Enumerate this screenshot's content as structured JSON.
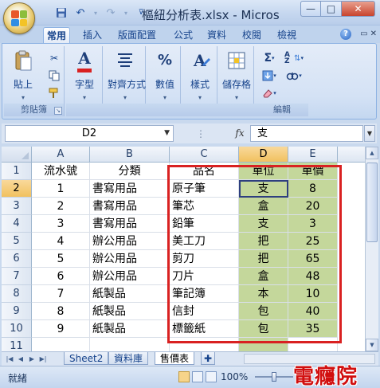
{
  "window": {
    "title": "樞紐分析表.xlsx - Micros",
    "minimize": "—",
    "maximize": "□",
    "close": "✕"
  },
  "qat": {
    "save_icon": "save-icon",
    "undo_icon": "undo-icon",
    "redo_icon": "redo-icon",
    "customize_icon": "customize-icon"
  },
  "ribbon_tabs": [
    "常用",
    "插入",
    "版面配置",
    "公式",
    "資料",
    "校閱",
    "檢視"
  ],
  "ribbon": {
    "paste_label": "貼上",
    "clipboard_label": "剪貼簿",
    "font_label": "字型",
    "align_label": "對齊方式",
    "number_label": "數值",
    "style_label": "樣式",
    "cells_label": "儲存格",
    "edit_label": "編輯",
    "number_glyph": "%",
    "font_glyph": "A",
    "sigma_glyph": "Σ",
    "sort_glyph": "A Z"
  },
  "formula_bar": {
    "name_box": "D2",
    "fx": "fx",
    "value": "支"
  },
  "grid": {
    "columns": [
      "A",
      "B",
      "C",
      "D",
      "E"
    ],
    "rows": [
      "1",
      "2",
      "3",
      "4",
      "5",
      "6",
      "7",
      "8",
      "9",
      "10",
      "11"
    ],
    "header": [
      "流水號",
      "分類",
      "品名",
      "單位",
      "單價"
    ],
    "data": [
      [
        "1",
        "書寫用品",
        "原子筆",
        "支",
        "8"
      ],
      [
        "2",
        "書寫用品",
        "筆芯",
        "盒",
        "20"
      ],
      [
        "3",
        "書寫用品",
        "鉛筆",
        "支",
        "3"
      ],
      [
        "4",
        "辦公用品",
        "美工刀",
        "把",
        "25"
      ],
      [
        "5",
        "辦公用品",
        "剪刀",
        "把",
        "65"
      ],
      [
        "6",
        "辦公用品",
        "刀片",
        "盒",
        "48"
      ],
      [
        "7",
        "紙製品",
        "筆記簿",
        "本",
        "10"
      ],
      [
        "8",
        "紙製品",
        "信封",
        "包",
        "40"
      ],
      [
        "9",
        "紙製品",
        "標籤紙",
        "包",
        "35"
      ]
    ],
    "active_cell": "D2"
  },
  "sheets": [
    "Sheet2",
    "資料庫",
    "售價表"
  ],
  "status": {
    "mode": "就緒",
    "zoom": "100%",
    "zoom_minus": "⊖",
    "zoom_plus": "⊕"
  },
  "watermark": "電癮院",
  "colors": {
    "highlight_green": "#c4d79b",
    "red_box": "#d92121",
    "watermark": "#d10f0f"
  }
}
